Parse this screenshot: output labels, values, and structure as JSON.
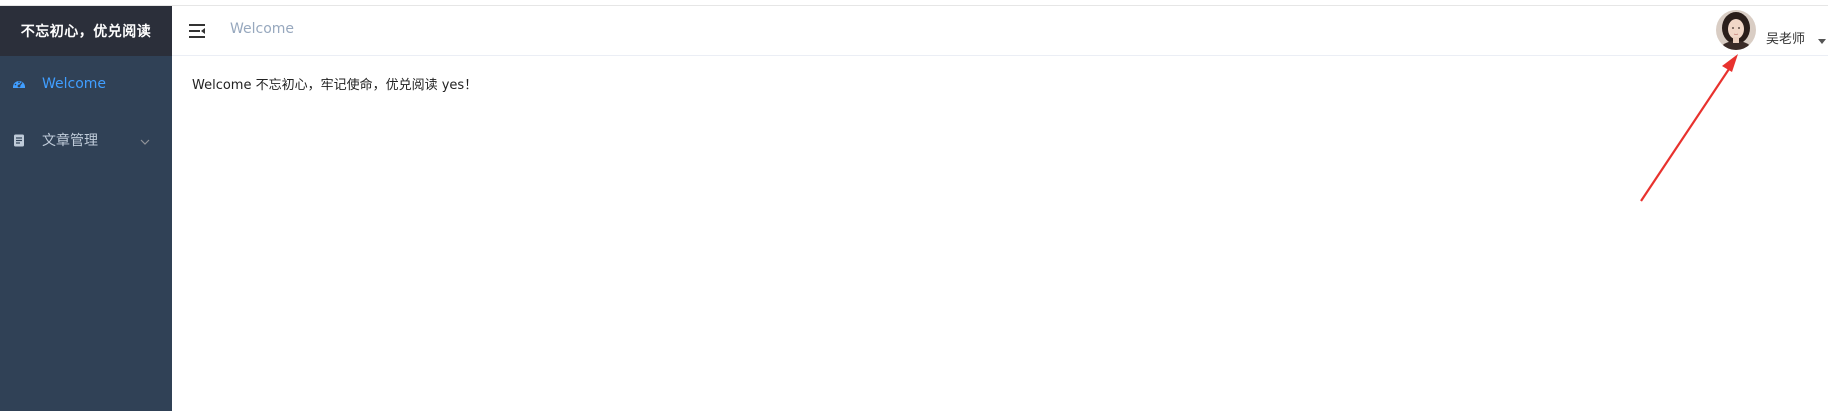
{
  "sidebar": {
    "logo_text": "不忘初心，优兑阅读",
    "items": [
      {
        "label": "Welcome",
        "icon": "dashboard-icon",
        "active": true
      },
      {
        "label": "文章管理",
        "icon": "document-icon",
        "active": false,
        "expandable": true
      }
    ]
  },
  "header": {
    "breadcrumb": "Welcome",
    "user": {
      "name": "吴老师",
      "avatar": "user-avatar"
    }
  },
  "main": {
    "welcome_message": "Welcome 不忘初心，牢记使命，优兑阅读 yes！"
  },
  "colors": {
    "sidebar_bg": "#304156",
    "logo_bg": "#2b2f3a",
    "active_text": "#409eff",
    "menu_text": "#bfcbd9",
    "breadcrumb_text": "#97a8be",
    "annotation_arrow": "#e8322e"
  }
}
